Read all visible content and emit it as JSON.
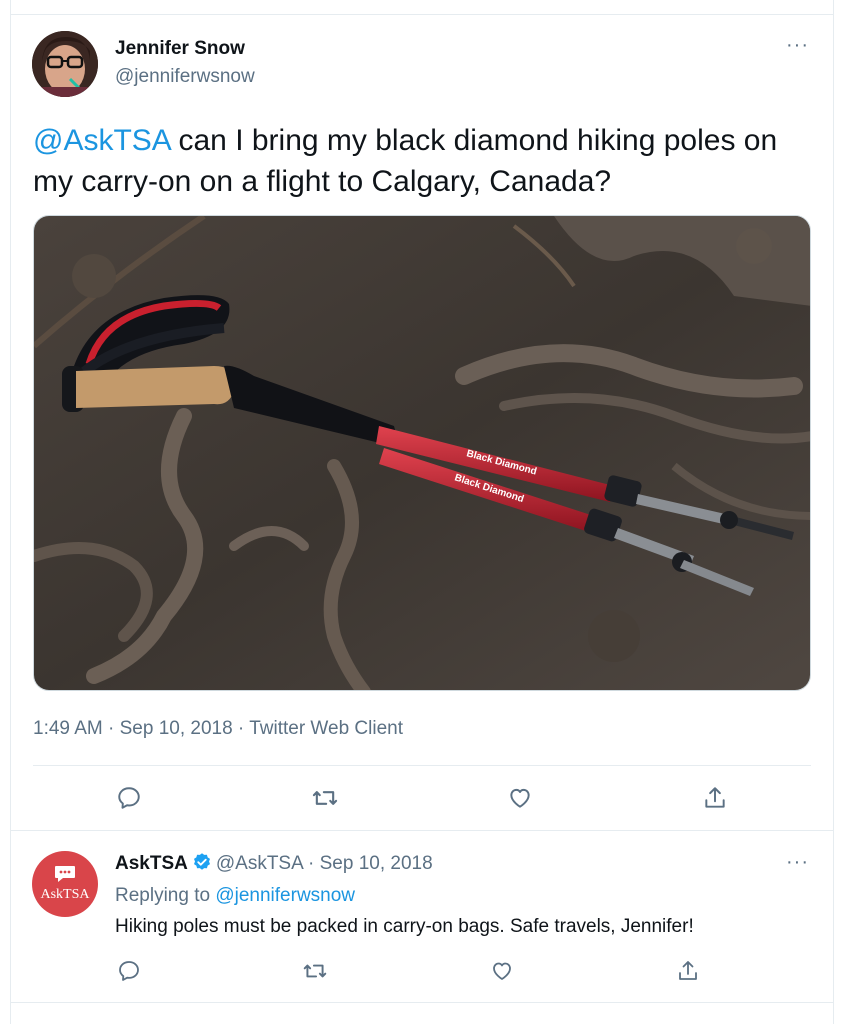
{
  "main_tweet": {
    "author_name": "Jennifer Snow",
    "author_handle": "@jenniferwsnow",
    "more_label": "···",
    "mention": "@AskTSA",
    "text": " can I bring my black diamond hiking poles on my carry-on on a flight to Calgary, Canada?",
    "media": {
      "pole_brand_1": "Black Diamond",
      "pole_brand_2": "Black Diamond"
    },
    "time": "1:49 AM",
    "date": "Sep 10, 2018",
    "client": "Twitter Web Client",
    "meta_separator": " · ",
    "actions": {
      "reply_icon": "reply-icon",
      "retweet_icon": "retweet-icon",
      "like_icon": "heart-icon",
      "share_icon": "share-icon"
    }
  },
  "reply_tweet": {
    "avatar_label": "AskTSA",
    "author_name": "AskTSA",
    "author_handle": "@AskTSA",
    "separator": " · ",
    "date": "Sep 10, 2018",
    "more_label": "···",
    "replying_to_prefix": "Replying to ",
    "replying_to_handle": "@jenniferwsnow",
    "text": "Hiking poles must be packed in carry-on bags. Safe travels, Jennifer!"
  },
  "colors": {
    "link": "#1b95e0",
    "secondary_text": "#5b7083",
    "primary_text": "#0f1419",
    "verified": "#1da1f2",
    "tsa_avatar": "#d9454a",
    "divider": "#e6ecf0"
  }
}
